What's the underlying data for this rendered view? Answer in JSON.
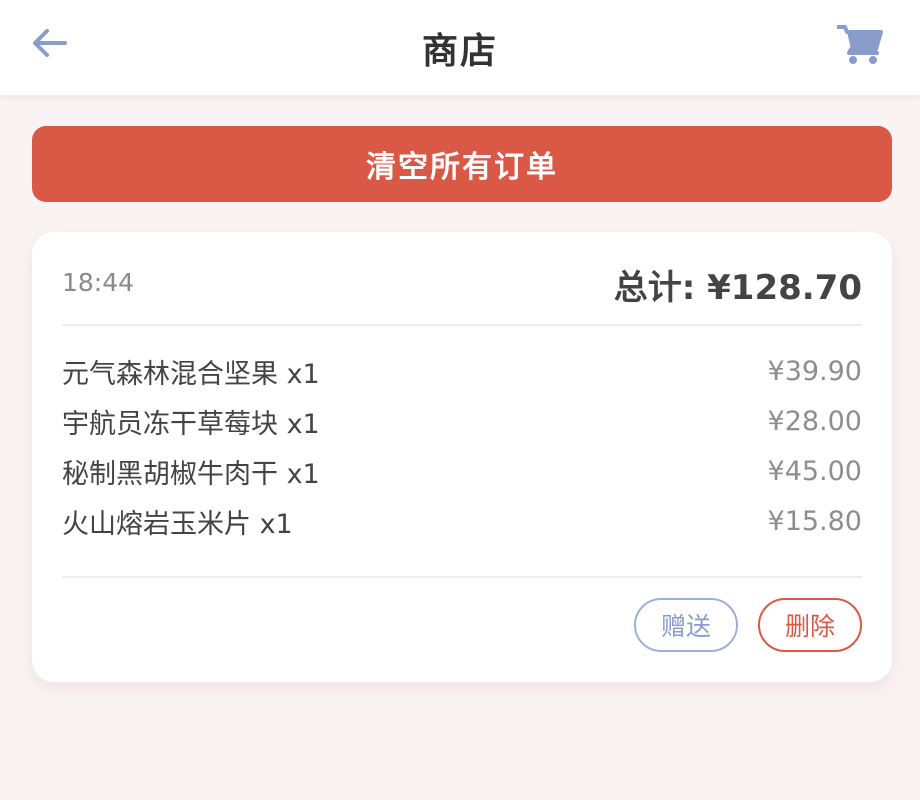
{
  "header": {
    "title": "商店",
    "back_icon": "arrow-left-icon",
    "cart_icon": "cart-icon"
  },
  "actions": {
    "clear_label": "清空所有订单"
  },
  "orders": [
    {
      "time": "18:44",
      "total": "总计: ¥128.70",
      "items": [
        {
          "name": "元气森林混合坚果 x1",
          "price": "¥39.90"
        },
        {
          "name": "宇航员冻干草莓块 x1",
          "price": "¥28.00"
        },
        {
          "name": "秘制黑胡椒牛肉干 x1",
          "price": "¥45.00"
        },
        {
          "name": "火山熔岩玉米片 x1",
          "price": "¥15.80"
        }
      ],
      "gift_label": "赠送",
      "delete_label": "删除"
    }
  ],
  "colors": {
    "accent": "#8a9ccc",
    "danger": "#d95846",
    "background": "#faf3f4"
  }
}
